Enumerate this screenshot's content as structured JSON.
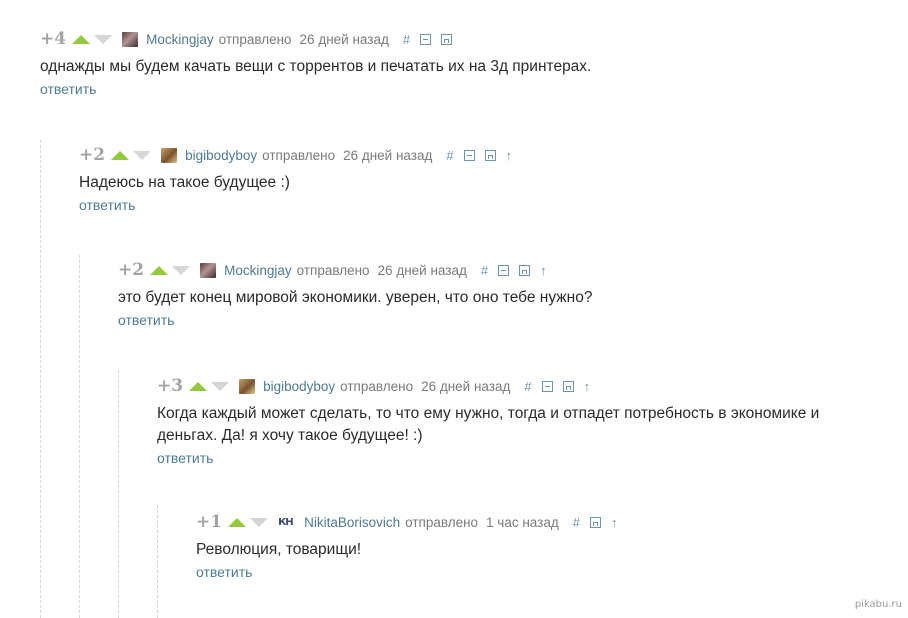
{
  "comments": [
    {
      "score": "+4",
      "user": "Mockingjay",
      "sent": "отправлено",
      "time": "26 дней назад",
      "link": "#",
      "text": "однажды мы будем качать вещи с торрентов и печатать их на 3д принтерах.",
      "reply": "ответить"
    },
    {
      "score": "+2",
      "user": "bigibodyboy",
      "sent": "отправлено",
      "time": "26 дней назад",
      "link": "#",
      "text": "Надеюсь на такое будущее :)",
      "reply": "ответить"
    },
    {
      "score": "+2",
      "user": "Mockingjay",
      "sent": "отправлено",
      "time": "26 дней назад",
      "link": "#",
      "text": "это будет конец мировой экономики. уверен, что оно тебе нужно?",
      "reply": "ответить"
    },
    {
      "score": "+3",
      "user": "bigibodyboy",
      "sent": "отправлено",
      "time": "26 дней назад",
      "link": "#",
      "text": "Когда каждый может сделать, то что ему нужно, тогда и отпадет потребность в экономике и деньгах. Да! я хочу такое будущее! :)",
      "reply": "ответить"
    },
    {
      "score": "+1",
      "user": "NikitaBorisovich",
      "avatar_text": "КН",
      "sent": "отправлено",
      "time": "1 час назад",
      "link": "#",
      "text": "Революция, товарищи!",
      "reply": "ответить"
    }
  ],
  "watermark": "pikabu.ru",
  "colors": {
    "upvote": "#93c93b",
    "downvote": "#d6d6d6",
    "username": "#4f7a96",
    "score": "#a3a3a3"
  }
}
